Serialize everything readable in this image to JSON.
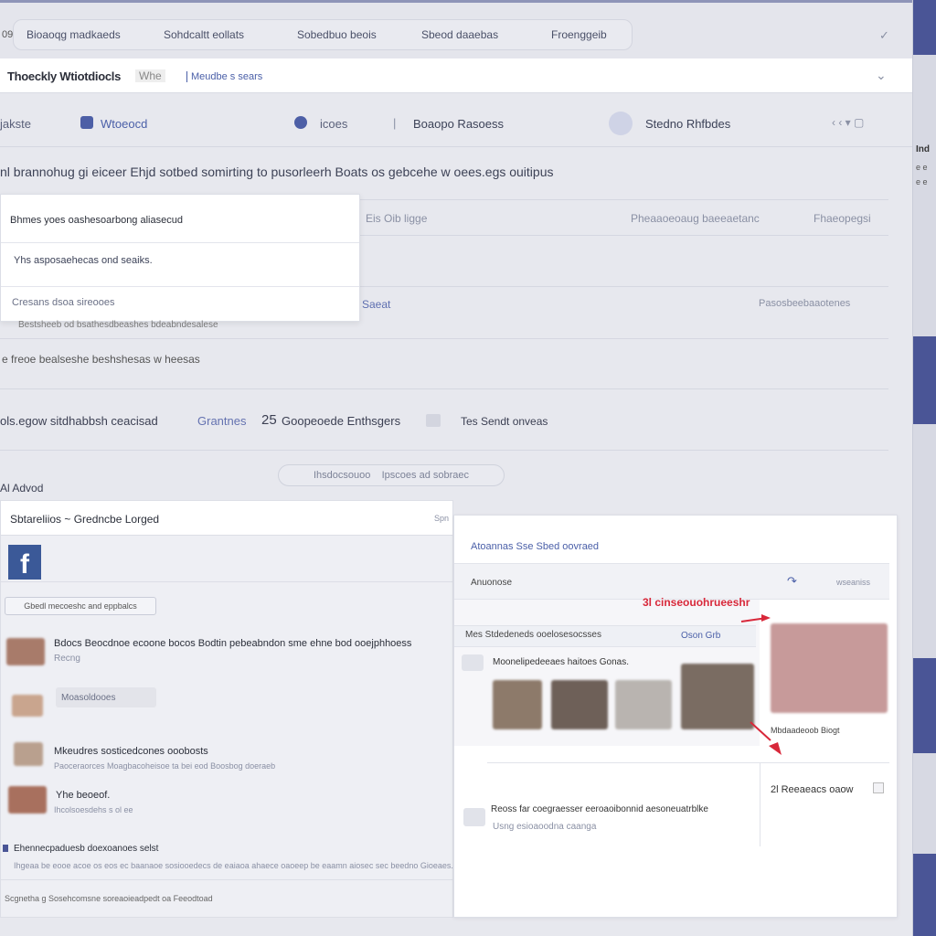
{
  "topbar": {
    "tabs": [
      "Bioaoqg madkaeds",
      "Sohdcaltt eollats",
      "Sobedbuo beois",
      "Sbeod daaebas",
      "Froenggeib"
    ],
    "left_fragment": "09"
  },
  "header": {
    "title": "Thoeckly Wtiotdiocls",
    "badge": "Whe",
    "subtitle": "Meudbe s sears"
  },
  "nav": {
    "items": [
      "jakste",
      "Wtoeocd",
      "icoes",
      "Boaopo Rasoess",
      "Stedno Rhfbdes"
    ]
  },
  "headline": "nl brannohug gi eiceer Ehjd sotbed somirting to pusorleerh Boats os gebcehe w oees.egs ouitipus",
  "table": {
    "headers": [
      "Eis Oib ligge",
      "Pheaaoeoaug baeeaetanc",
      "Fhaeopegsi"
    ],
    "row_right": "Pasosbeebaaotenes",
    "row_mid": "Saeat"
  },
  "popup": {
    "title": "Bhmes yoes oashesoarbong aliasecud",
    "line1": "Yhs asposaehecas ond seaiks.",
    "line2": "Cresans dsoa sireooes"
  },
  "lines": {
    "a": "Bestsheeb od bsathesdbeashes bdeabndesalese",
    "b": "e freoe bealseshe beshshesas w heesas"
  },
  "filters": {
    "label": "ols.egow sitdhabbsh ceacisad",
    "link": "Grantnes",
    "count": "25",
    "count_label": "Goopeoede Enthsgers",
    "check_label": "Tes Sendt onveas"
  },
  "center_pill": {
    "a": "Ihsdocsouoo",
    "b": "Ipscoes ad sobraec"
  },
  "section": {
    "title": "Al Advod"
  },
  "left_card": {
    "title": "Sbtareliios ~ Gredncbe Lorged",
    "meta": "Spn",
    "logo": "f",
    "button": "Gbedl mecoeshc and eppbalcs",
    "items": [
      {
        "title": "Bdocs Beocdnoe ecoone bocos Bodtin pebeabndon sme ehne bod ooejphhoess",
        "sub": "Recng"
      },
      {
        "title": "Moasoldooes",
        "sub": ""
      },
      {
        "title": "Mkeudres sosticedcones ooobosts",
        "sub": "Paoceraorces Moagbacoheisoe ta bei eod Boosbog doeraeb"
      },
      {
        "title": "Yhe beoeof.",
        "sub": "Ihcolsoesdehs s ol ee"
      }
    ],
    "footer_title": "Ehennecpaduesb doexoanoes selst",
    "footer_text": "Ihgeaa be eooe acoe os eos ec baanaoe sosiooedecs de eaiaoa ahaece oaoeep be eaamn aiosec sec beedno Gioeaes.",
    "bottom": "Scgnetha g Sosehcomsne soreaoieadpedt oa Feeodtoad"
  },
  "right_card": {
    "title": "Atoannas Sse Sbed oovraed",
    "tab_left": "Anuonose",
    "tab_right": "wseaniss",
    "annotation": "3l cinseouohrueeshr",
    "row1": "Mes Stdedeneds ooelosesocsses",
    "row1_right": "Oson Grb",
    "row2": "Moonelipedeeaes haitoes Gonas.",
    "caption": "Mbdaadeoob Biogt",
    "count": "2l Reeaeacs oaow",
    "bottom_title": "Reoss far coegraesser eeroaoibonnid aesoneuatrblke",
    "bottom_sub": "Usng esioaoodna caanga"
  },
  "colors": {
    "accent": "#4a5596",
    "fb_blue": "#3b5998",
    "link": "#4a5fa8",
    "annotation_red": "#d8283a"
  }
}
